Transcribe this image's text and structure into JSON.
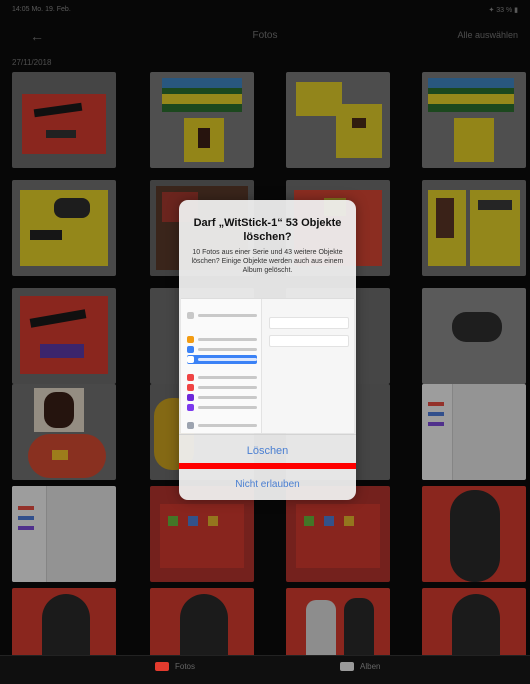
{
  "status": {
    "time": "14:05  Mo. 19. Feb.",
    "right": "✦ 33 % ▮"
  },
  "nav": {
    "back_icon": "←",
    "title": "Fotos",
    "select_all": "Alle auswählen"
  },
  "date_header": "27/11/2018",
  "alert": {
    "title": "Darf „WitStick-1“ 53 Objekte löschen?",
    "message": "10 Fotos aus einer Serie und 43 weitere Objekte löschen? Einige Objekte werden auch aus einem Album gelöscht.",
    "delete_label": "Löschen",
    "deny_label": "Nicht erlauben"
  },
  "tabs": [
    {
      "label": "Fotos",
      "color": "#e33b2e"
    },
    {
      "label": "Alben",
      "color": "#9a9a9a"
    }
  ],
  "colors": {
    "accent": "#4a7fd2",
    "highlight": "#ff0000"
  }
}
